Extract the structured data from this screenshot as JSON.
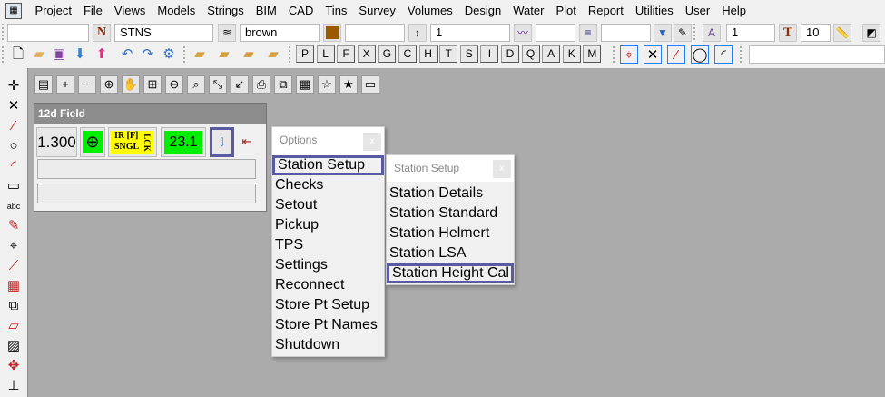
{
  "menu": [
    "Project",
    "File",
    "Views",
    "Models",
    "Strings",
    "BIM",
    "CAD",
    "Tins",
    "Survey",
    "Volumes",
    "Design",
    "Water",
    "Plot",
    "Report",
    "Utilities",
    "User",
    "Help"
  ],
  "toolbar1": {
    "model_value": "",
    "string_name": "STNS",
    "colour": "brown",
    "colour_hex": "#9a5a00",
    "field3": "",
    "weight": "1",
    "field5": "",
    "field6": "",
    "text_size": "1",
    "text_height": "10",
    "n_label": "N",
    "t_label": "T"
  },
  "letter_buttons": [
    "P",
    "L",
    "F",
    "X",
    "G",
    "C",
    "H",
    "T",
    "S",
    "I",
    "D",
    "Q",
    "A",
    "K",
    "M"
  ],
  "field_panel": {
    "title": "12d Field",
    "height_value": "1.300",
    "mode_line1": "IR [F]",
    "mode_line2": "SNGL",
    "mode_side": "LCK",
    "temp_value": "23.1",
    "accent": "#00ee00",
    "mode_bg": "#ffff00"
  },
  "options_popup": {
    "title": "Options",
    "close": "x",
    "items": [
      "Station Setup",
      "Checks",
      "Setout",
      "Pickup",
      "TPS",
      "Settings",
      "Reconnect",
      "Store Pt Setup",
      "Store Pt Names",
      "Shutdown"
    ],
    "selected": "Station Setup"
  },
  "submenu": {
    "title": "Station Setup",
    "close": "x",
    "items": [
      "Station Details",
      "Station Standard",
      "Station Helmert",
      "Station LSA",
      "Station Height Cal"
    ],
    "selected": "Station Height Cal"
  }
}
